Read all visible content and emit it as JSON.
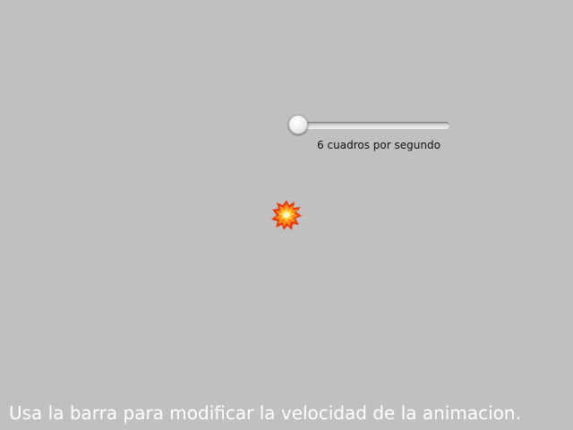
{
  "slider": {
    "value": 6,
    "min": 6,
    "max": 60,
    "label": "6 cuadros por segundo"
  },
  "sprite": {
    "icon": "explosion-icon"
  },
  "footer": {
    "instructions": "Usa la barra para modificar la velocidad de la animacion."
  },
  "colors": {
    "background": "#c0c0c0",
    "footer_text": "#ffffff",
    "label_text": "#111111"
  }
}
